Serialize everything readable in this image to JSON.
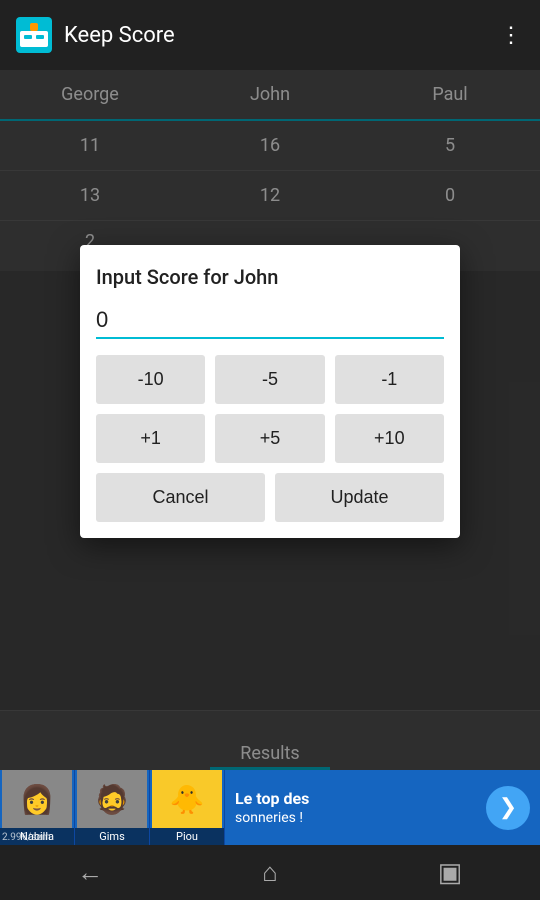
{
  "appBar": {
    "title": "Keep Score",
    "overflowIcon": "⋮"
  },
  "table": {
    "headers": [
      "George",
      "John",
      "Paul"
    ],
    "rows": [
      [
        "11",
        "16",
        "5"
      ],
      [
        "13",
        "12",
        "0"
      ]
    ],
    "partialRow": [
      "2",
      "",
      ""
    ]
  },
  "dialog": {
    "title": "Input Score for John",
    "inputValue": "0",
    "buttons": {
      "row1": [
        "-10",
        "-5",
        "-1"
      ],
      "row2": [
        "+1",
        "+5",
        "+10"
      ]
    },
    "cancelLabel": "Cancel",
    "updateLabel": "Update"
  },
  "resultsBar": {
    "label": "Results"
  },
  "adBanner": {
    "people": [
      {
        "emoji": "👩",
        "name": "Nabilla"
      },
      {
        "emoji": "👨",
        "name": "Gims"
      },
      {
        "emoji": "🐥",
        "name": "Piou"
      }
    ],
    "priceText": "2.99€/sem",
    "mainText": "Le top des",
    "subText": "sonneries !",
    "arrowIcon": "❯"
  },
  "bottomNav": {
    "backIcon": "←",
    "homeIcon": "⌂",
    "recentIcon": "▣"
  }
}
